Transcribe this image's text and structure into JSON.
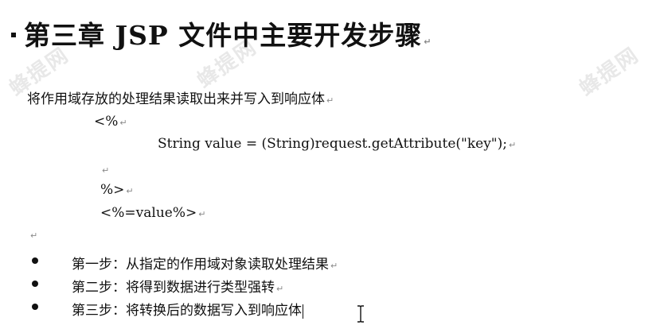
{
  "title": "第三章 JSP 文件中主要开发步骤",
  "paragraph": "将作用域存放的处理结果读取出来并写入到响应体",
  "code_lines": [
    "<%",
    "String value = (String)request.getAttribute(\"key\");",
    "",
    "%>",
    "<%=value%>"
  ],
  "paragraph_mark": "↵",
  "steps": [
    "第一步：从指定的作用域对象读取处理结果",
    "第二步：将得到数据进行类型强转",
    "第三步：将转换后的数据写入到响应体"
  ],
  "watermark_text": "蜂提网"
}
